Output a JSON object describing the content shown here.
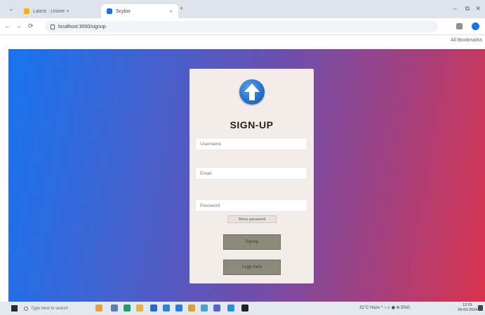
{
  "browser": {
    "tabs": [
      {
        "label": "Latest · Univer ×",
        "favicon_color": "#f4b400"
      },
      {
        "label": "Scylox",
        "favicon_color": "#1a73e8"
      }
    ],
    "close_glyph": "×",
    "new_tab_glyph": "+",
    "tab_search_glyph": "⌄",
    "window_controls": {
      "minimize": "–",
      "maximize": "⧉",
      "close": "✕"
    },
    "nav": {
      "back": "←",
      "forward": "→",
      "reload": "⟳"
    },
    "url": "localhost:3000/signup",
    "bookmarks": {
      "other_label": "All Bookmarks"
    }
  },
  "page": {
    "background_colors": [
      "#1773f0",
      "#6a4fb0",
      "#d9334d"
    ],
    "logo_icon": "arrow-up-circle-icon",
    "title": "SIGN-UP",
    "username_placeholder": "Username",
    "email_placeholder": "Email",
    "password_placeholder": "Password",
    "show_password_label": "Show password",
    "signup_button": "Signup",
    "login_button": "Login here",
    "button_color": "#8c8a7a"
  },
  "taskbar": {
    "search_placeholder": "Type here to search",
    "apps": [
      {
        "name": "photos-app-icon",
        "color": "#e3a23b"
      },
      {
        "name": "task-view-icon",
        "color": "#5d7ea8"
      },
      {
        "name": "edge-app-icon",
        "color": "#1e9c6d"
      },
      {
        "name": "file-explorer-icon",
        "color": "#e6b33c"
      },
      {
        "name": "store-app-icon",
        "color": "#2b69c4"
      },
      {
        "name": "mail-app-icon",
        "color": "#2a86d6"
      },
      {
        "name": "chrome-app-icon",
        "color": "#2f7be5"
      },
      {
        "name": "settings-app-icon",
        "color": "#d9a22c"
      },
      {
        "name": "maps-app-icon",
        "color": "#4aa3c2"
      },
      {
        "name": "teams-app-icon",
        "color": "#5464c7"
      },
      {
        "name": "vscode-app-icon",
        "color": "#2a8fd6"
      },
      {
        "name": "terminal-app-icon",
        "color": "#222222"
      }
    ],
    "weather": "31°C Haze",
    "tray_icons": "^ ⌂ ◐ ◼ ⊕ ENG",
    "time": "12:01",
    "date": "29-03-2024"
  }
}
